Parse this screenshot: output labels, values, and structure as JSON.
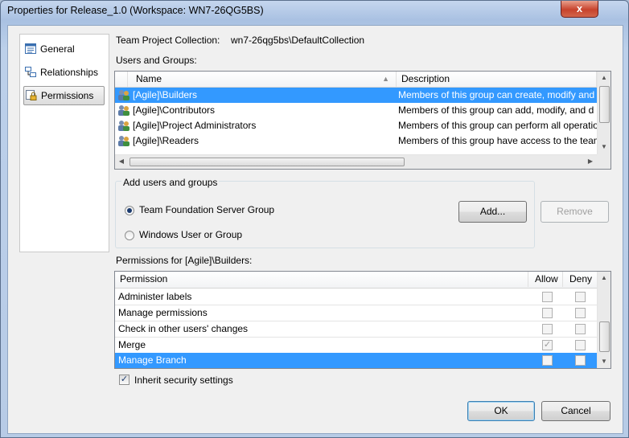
{
  "window": {
    "title": "Properties for Release_1.0 (Workspace: WN7-26QG5BS)",
    "close_glyph": "x"
  },
  "nav": {
    "items": [
      {
        "label": "General",
        "icon": "general-properties-icon"
      },
      {
        "label": "Relationships",
        "icon": "relationships-icon"
      },
      {
        "label": "Permissions",
        "icon": "permissions-lock-icon",
        "selected": true
      }
    ]
  },
  "collection": {
    "label": "Team Project Collection:",
    "value": "wn7-26qg5bs\\DefaultCollection"
  },
  "users_groups": {
    "label": "Users and Groups:",
    "columns": [
      "Name",
      "Description"
    ],
    "rows": [
      {
        "name": "[Agile]\\Builders",
        "description": "Members of this group can create, modify and",
        "selected": true
      },
      {
        "name": "[Agile]\\Contributors",
        "description": "Members of this group can add, modify, and d"
      },
      {
        "name": "[Agile]\\Project Administrators",
        "description": "Members of this group can perform all operatio"
      },
      {
        "name": "[Agile]\\Readers",
        "description": "Members of this group have access to the team"
      }
    ]
  },
  "add_group": {
    "legend": "Add users and groups",
    "options": [
      {
        "label": "Team Foundation Server Group",
        "checked": true
      },
      {
        "label": "Windows User or Group",
        "checked": false
      }
    ],
    "add_button": "Add...",
    "remove_button": "Remove"
  },
  "permissions": {
    "label": "Permissions for [Agile]\\Builders:",
    "columns": [
      "Permission",
      "Allow",
      "Deny"
    ],
    "rows": [
      {
        "name": "Administer labels",
        "allow": false,
        "deny": false
      },
      {
        "name": "Manage permissions",
        "allow": false,
        "deny": false
      },
      {
        "name": "Check in other users' changes",
        "allow": false,
        "deny": false
      },
      {
        "name": "Merge",
        "allow": true,
        "deny": false
      },
      {
        "name": "Manage Branch",
        "allow": false,
        "deny": false,
        "selected": true
      }
    ]
  },
  "inherit": {
    "label": "Inherit security settings",
    "checked": true
  },
  "buttons": {
    "ok": "OK",
    "cancel": "Cancel"
  },
  "colors": {
    "selection": "#3399ff",
    "title_bar": "#b7cbe6",
    "close": "#c7432d"
  }
}
